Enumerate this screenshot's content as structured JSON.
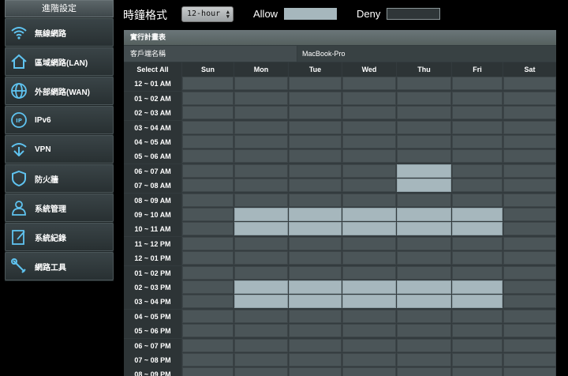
{
  "sidebar": {
    "header": "進階設定",
    "items": [
      {
        "label": "無線網路",
        "icon": "wifi-icon"
      },
      {
        "label": "區域網路(LAN)",
        "icon": "home-icon"
      },
      {
        "label": "外部網路(WAN)",
        "icon": "globe-icon"
      },
      {
        "label": "IPv6",
        "icon": "ipv6-icon"
      },
      {
        "label": "VPN",
        "icon": "vpn-icon"
      },
      {
        "label": "防火牆",
        "icon": "shield-icon"
      },
      {
        "label": "系統管理",
        "icon": "user-admin-icon"
      },
      {
        "label": "系統紀錄",
        "icon": "log-icon"
      },
      {
        "label": "網路工具",
        "icon": "tools-icon"
      }
    ]
  },
  "topbar": {
    "time_format_label": "時鐘格式",
    "time_format_value": "12-hour",
    "allow_label": "Allow",
    "deny_label": "Deny",
    "allow_color": "#a6b7bd",
    "deny_color": "#2f3638"
  },
  "schedule": {
    "title": "實行計畫表",
    "client_label": "客戶端名稱",
    "client_value": "MacBook-Pro",
    "select_all_label": "Select All",
    "days": [
      "Sun",
      "Mon",
      "Tue",
      "Wed",
      "Thu",
      "Fri",
      "Sat"
    ],
    "time_slots": [
      "12 ~ 01 AM",
      "01 ~ 02 AM",
      "02 ~ 03 AM",
      "03 ~ 04 AM",
      "04 ~ 05 AM",
      "05 ~ 06 AM",
      "06 ~ 07 AM",
      "07 ~ 08 AM",
      "08 ~ 09 AM",
      "09 ~ 10 AM",
      "10 ~ 11 AM",
      "11 ~ 12 PM",
      "12 ~ 01 PM",
      "01 ~ 02 PM",
      "02 ~ 03 PM",
      "03 ~ 04 PM",
      "04 ~ 05 PM",
      "05 ~ 06 PM",
      "06 ~ 07 PM",
      "07 ~ 08 PM",
      "08 ~ 09 PM"
    ],
    "allowed": [
      [
        0,
        0,
        0,
        0,
        0,
        0,
        0
      ],
      [
        0,
        0,
        0,
        0,
        0,
        0,
        0
      ],
      [
        0,
        0,
        0,
        0,
        0,
        0,
        0
      ],
      [
        0,
        0,
        0,
        0,
        0,
        0,
        0
      ],
      [
        0,
        0,
        0,
        0,
        0,
        0,
        0
      ],
      [
        0,
        0,
        0,
        0,
        0,
        0,
        0
      ],
      [
        0,
        0,
        0,
        0,
        1,
        0,
        0
      ],
      [
        0,
        0,
        0,
        0,
        1,
        0,
        0
      ],
      [
        0,
        0,
        0,
        0,
        0,
        0,
        0
      ],
      [
        0,
        1,
        1,
        1,
        1,
        1,
        0
      ],
      [
        0,
        1,
        1,
        1,
        1,
        1,
        0
      ],
      [
        0,
        0,
        0,
        0,
        0,
        0,
        0
      ],
      [
        0,
        0,
        0,
        0,
        0,
        0,
        0
      ],
      [
        0,
        0,
        0,
        0,
        0,
        0,
        0
      ],
      [
        0,
        1,
        1,
        1,
        1,
        1,
        0
      ],
      [
        0,
        1,
        1,
        1,
        1,
        1,
        0
      ],
      [
        0,
        0,
        0,
        0,
        0,
        0,
        0
      ],
      [
        0,
        0,
        0,
        0,
        0,
        0,
        0
      ],
      [
        0,
        0,
        0,
        0,
        0,
        0,
        0
      ],
      [
        0,
        0,
        0,
        0,
        0,
        0,
        0
      ],
      [
        0,
        0,
        0,
        0,
        0,
        0,
        0
      ]
    ]
  }
}
